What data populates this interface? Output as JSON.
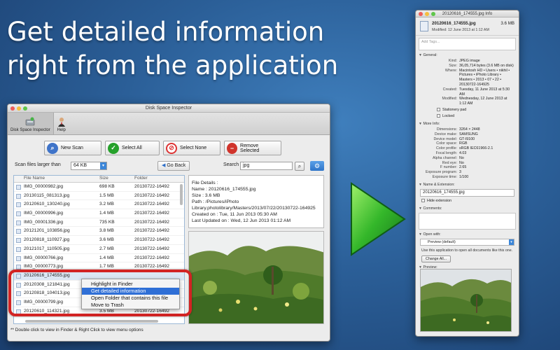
{
  "headline": {
    "line1": "Get detailed information",
    "line2": "right from the application"
  },
  "main_window": {
    "title": "Disk Space Inspector",
    "toolbar": [
      {
        "label": "Disk Space Inspector",
        "icon": "disk-inspector-icon"
      },
      {
        "label": "Help",
        "icon": "help-person-icon"
      }
    ],
    "actions": {
      "new_scan": "New Scan",
      "select_all": "Select All",
      "select_none": "Select None",
      "remove_selected": "Remove Selected"
    },
    "scan_label": "Scan files larger than",
    "scan_value": "64 KB",
    "go_back": "Go Back",
    "search_label": "Search",
    "search_value": "jpg",
    "columns": {
      "name": "File Name",
      "size": "Size",
      "folder": "Folder"
    },
    "rows": [
      {
        "name": "IMG_00000982.jpg",
        "size": "698 KB",
        "folder": "20130722-16492"
      },
      {
        "name": "20130115_081313.jpg",
        "size": "1.5 MB",
        "folder": "20130722-16492"
      },
      {
        "name": "20120610_130240.jpg",
        "size": "3.2 MB",
        "folder": "20130722-16492"
      },
      {
        "name": "IMG_00000996.jpg",
        "size": "1.4 MB",
        "folder": "20130722-16492"
      },
      {
        "name": "IMG_00001336.jpg",
        "size": "735 KB",
        "folder": "20130722-16492"
      },
      {
        "name": "20121201_103856.jpg",
        "size": "3.8 MB",
        "folder": "20130722-16492"
      },
      {
        "name": "20120818_110927.jpg",
        "size": "3.6 MB",
        "folder": "20130722-16492"
      },
      {
        "name": "20121017_110505.jpg",
        "size": "2.7 MB",
        "folder": "20130722-16492"
      },
      {
        "name": "IMG_00000766.jpg",
        "size": "1.4 MB",
        "folder": "20130722-16492"
      },
      {
        "name": "IMG_00000773.jpg",
        "size": "1.7 MB",
        "folder": "20130722-16492"
      },
      {
        "name": "20120616_174555.jpg",
        "size": "",
        "folder": ""
      },
      {
        "name": "20120308_121841.jpg",
        "size": "",
        "folder": ""
      },
      {
        "name": "20120818_104013.jpg",
        "size": "",
        "folder": ""
      },
      {
        "name": "IMG_00000799.jpg",
        "size": "",
        "folder": ""
      },
      {
        "name": "20120610_114321.jpg",
        "size": "3.5 MB",
        "folder": "20130722-16492"
      }
    ],
    "context_menu": [
      "Highlight in Finder",
      "Get detailed information",
      "Open Folder that contains this file",
      "Move to Trash"
    ],
    "details": {
      "heading": "File Details :",
      "name": "Name : 20120616_174555.jpg",
      "size": "Size : 3.6 MB",
      "path": "Path : /Pictures/iPhoto Library.photolibrary/Masters/2013/07/22/20130722-164925",
      "created": "Created on : Tue, 11 Jun 2013 05:30 AM",
      "updated": "Last Updated on : Wed, 12 Jun 2013 01:12 AM"
    },
    "footnote": "** Double click to view in Finder & Right Click to view menu options"
  },
  "info_panel": {
    "title": "20120616_174555.jpg Info",
    "file_name": "20120616_174555.jpg",
    "file_size": "3.6 MB",
    "modified_short": "Modified: 12 June 2013 at 1:12 AM",
    "tags_placeholder": "Add Tags...",
    "general_header": "General:",
    "general": [
      {
        "k": "Kind:",
        "v": "JPEG image"
      },
      {
        "k": "Size:",
        "v": "36,05,714 bytes (3.6 MB on disk)"
      },
      {
        "k": "Where:",
        "v": "Macintosh HD • Users • nikhil • Pictures • iPhoto Library • Masters • 2013 • 07 • 22 • 20130722-164925"
      },
      {
        "k": "Created:",
        "v": "Tuesday, 11 June 2013 at 5:30 AM"
      },
      {
        "k": "Modified:",
        "v": "Wednesday, 12 June 2013 at 1:12 AM"
      }
    ],
    "stationery": "Stationery pad",
    "locked": "Locked",
    "more_header": "More Info:",
    "more": [
      {
        "k": "Dimensions:",
        "v": "3264 × 2448"
      },
      {
        "k": "Device make:",
        "v": "SAMSUNG"
      },
      {
        "k": "Device model:",
        "v": "GT-I9100"
      },
      {
        "k": "Color space:",
        "v": "RGB"
      },
      {
        "k": "Color profile:",
        "v": "sRGB IEC61966-2.1"
      },
      {
        "k": "Focal length:",
        "v": "4.03"
      },
      {
        "k": "Alpha channel:",
        "v": "No"
      },
      {
        "k": "Red eye:",
        "v": "No"
      },
      {
        "k": "F number:",
        "v": "2.65"
      },
      {
        "k": "Exposure program:",
        "v": "3"
      },
      {
        "k": "Exposure time:",
        "v": "1/100"
      }
    ],
    "name_ext_header": "Name & Extension:",
    "name_value": "20120616_174555.jpg",
    "hide_ext": "Hide extension",
    "comments_header": "Comments:",
    "open_with_header": "Open with:",
    "open_with_value": "Preview (default)",
    "open_with_note": "Use this application to open all documents like this one.",
    "change_all": "Change All...",
    "preview_header": "Preview:"
  }
}
